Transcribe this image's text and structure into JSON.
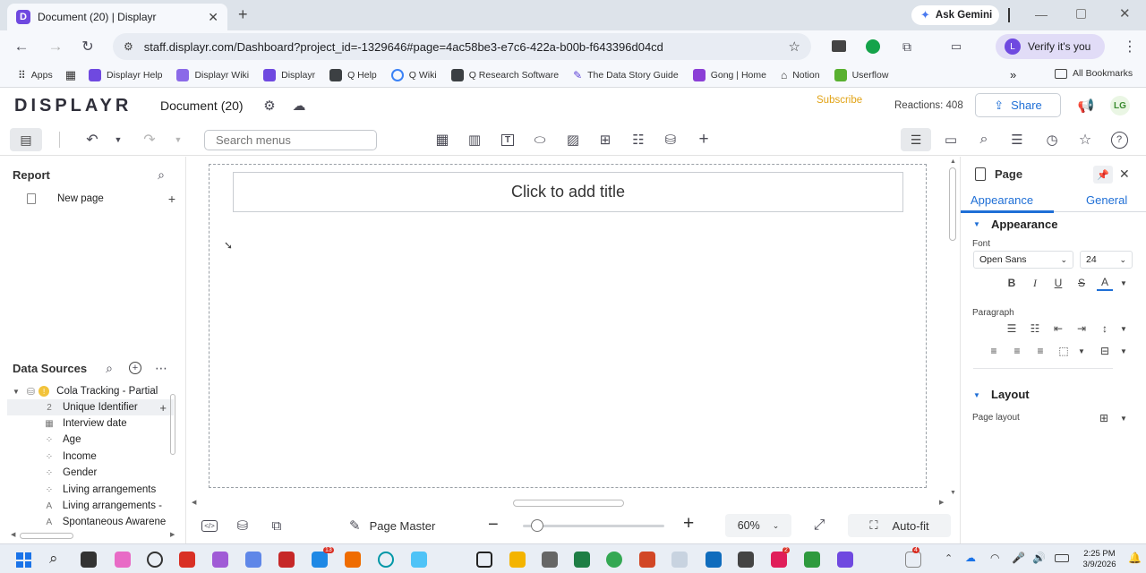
{
  "browser": {
    "tab_title": "Document (20) | Displayr",
    "new_tab": "+",
    "favicon_letter": "D",
    "ask_gemini": "Ask Gemini",
    "url": "staff.displayr.com/Dashboard?project_id=-1329646#page=4ac58be3-e7c6-422a-b00b-f643396d04cd",
    "verify_label": "Verify it's you",
    "avatar_letter": "L",
    "bookmarks": [
      "Apps",
      "Displayr Help",
      "Displayr Wiki",
      "Displayr",
      "Q Help",
      "Q Wiki",
      "Q Research Software",
      "The Data Story Guide",
      "Gong | Home",
      "Notion",
      "Userflow"
    ],
    "all_bookmarks": "All Bookmarks",
    "bookmark_colors": [
      "#5f6368",
      "#6f49e0",
      "#6f49e0",
      "#6f49e0",
      "#3c4043",
      "#3b82f6",
      "#3c4043",
      "#5b3fd6",
      "#8b3fd6",
      "#333333",
      "#59b02f"
    ]
  },
  "app": {
    "logo": "DISPLAYR",
    "doc_title": "Document (20)",
    "subscribe": "Subscribe",
    "reactions": "Reactions: 408",
    "share": "Share",
    "user_initials": "LG",
    "search_placeholder": "Search menus"
  },
  "left": {
    "report_title": "Report",
    "page_item": "New page",
    "data_sources_title": "Data Sources",
    "datasource_name": "Cola Tracking - Partial",
    "variables": [
      {
        "glyph": "2",
        "label": "Unique Identifier"
      },
      {
        "glyph": "▦",
        "label": "Interview date"
      },
      {
        "glyph": "⁘",
        "label": "Age"
      },
      {
        "glyph": "⁘",
        "label": "Income"
      },
      {
        "glyph": "⁘",
        "label": "Gender"
      },
      {
        "glyph": "⁘",
        "label": "Living arrangements"
      },
      {
        "glyph": "A",
        "label": "Living arrangements -"
      },
      {
        "glyph": "A",
        "label": "Spontaneous Awarene"
      }
    ]
  },
  "canvas": {
    "title_placeholder": "Click to add title"
  },
  "bottom": {
    "page_master": "Page Master",
    "zoom": "60%",
    "zoom_level": 0.1,
    "autofit": "Auto-fit"
  },
  "right": {
    "panel_title": "Page",
    "tab_appearance": "Appearance",
    "tab_general": "General",
    "section_appearance": "Appearance",
    "font_label": "Font",
    "font_family": "Open Sans",
    "font_size": "24",
    "paragraph_label": "Paragraph",
    "section_layout": "Layout",
    "page_layout_label": "Page layout",
    "accent": "#1f6fd6"
  },
  "taskbar": {
    "time": "2:25 PM",
    "date": "3/9/2026",
    "badge_1": "13",
    "badge_2": "2",
    "badge_3": "4"
  }
}
